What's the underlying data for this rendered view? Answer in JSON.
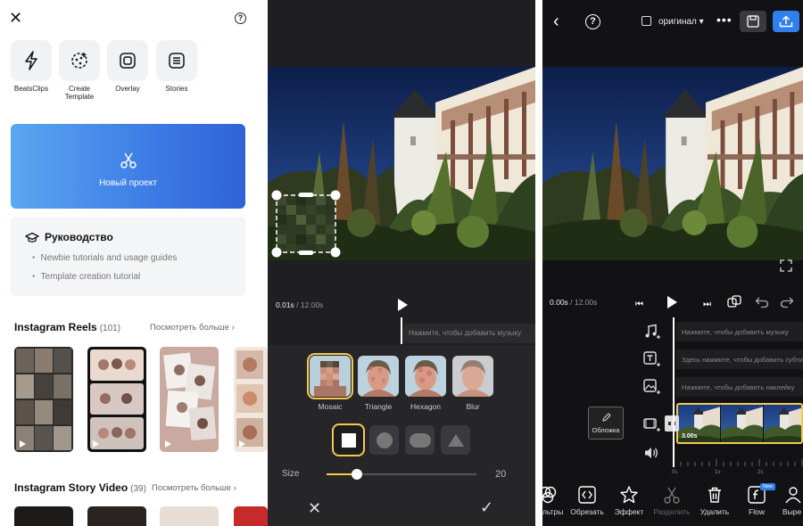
{
  "home": {
    "tools": [
      {
        "label": "BeatsClips",
        "icon": "bolt-icon"
      },
      {
        "label": "Create Template",
        "icon": "template-icon"
      },
      {
        "label": "Overlay",
        "icon": "overlay-icon"
      },
      {
        "label": "Stories",
        "icon": "stories-icon"
      }
    ],
    "new_project_label": "Новый проект",
    "guide": {
      "title": "Руководство",
      "items": [
        "Newbie tutorials and usage guides",
        "Template creation tutorial"
      ]
    },
    "reels": {
      "title": "Instagram Reels",
      "count": "(101)",
      "more": "Посмотреть больше"
    },
    "story": {
      "title": "Instagram Story Video",
      "count": "(39)",
      "more": "Посмотреть больше"
    }
  },
  "mosaic_editor": {
    "current_time": "0.01s",
    "total_time": "/ 12.00s",
    "music_hint": "Нажмите, чтобы добавить музыку",
    "effects": [
      {
        "label": "Mosaic",
        "selected": true
      },
      {
        "label": "Triangle",
        "selected": false
      },
      {
        "label": "Hexagon",
        "selected": false
      },
      {
        "label": "Blur",
        "selected": false
      }
    ],
    "shapes": [
      "square",
      "circle",
      "rounded-rectangle",
      "triangle"
    ],
    "size_label": "Size",
    "size_value": "20",
    "size_fraction": 0.2
  },
  "timeline_editor": {
    "ratio_label": "оригинал",
    "current_time": "0.00s",
    "total_time": "/ 12.00s",
    "tracks": [
      "Нажмите, чтобы добавить музыку",
      "Здесь нажмите, чтобы добавить субтитры",
      "Нажмите, чтобы добавить наклейку"
    ],
    "cover_label": "Обложка",
    "clip_duration": "3.00s",
    "ruler_ticks": [
      "0s",
      "1s",
      "2s"
    ],
    "toolbar": [
      {
        "label": "Фильтры",
        "icon": "filter-icon",
        "enabled": true
      },
      {
        "label": "Обрезать",
        "icon": "trim-icon",
        "enabled": true
      },
      {
        "label": "Эффект",
        "icon": "effect-icon",
        "enabled": true
      },
      {
        "label": "Разделить",
        "icon": "split-icon",
        "enabled": false
      },
      {
        "label": "Удалить",
        "icon": "delete-icon",
        "enabled": true
      },
      {
        "label": "Flow",
        "icon": "flow-icon",
        "enabled": true
      },
      {
        "label": "Выре",
        "icon": "cutout-icon",
        "enabled": true
      }
    ],
    "new_badge": "New"
  },
  "colors": {
    "accent": "#2f80ed",
    "selection": "#f2c94c",
    "dark_bg": "#1f1f21"
  }
}
